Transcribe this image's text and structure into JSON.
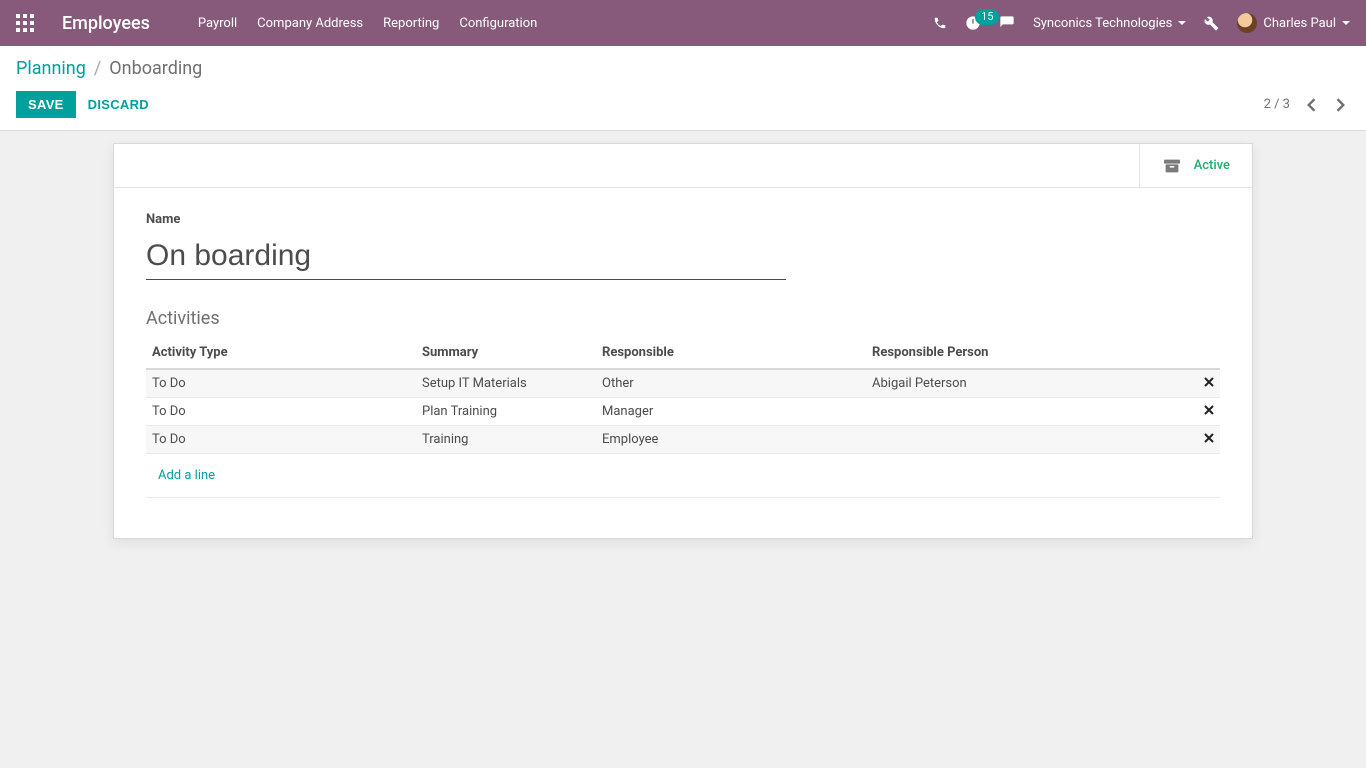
{
  "navbar": {
    "brand": "Employees",
    "menu": [
      "Payroll",
      "Company Address",
      "Reporting",
      "Configuration"
    ],
    "activity_count": "15",
    "company": "Synconics Technologies",
    "user": "Charles Paul"
  },
  "breadcrumb": {
    "parent": "Planning",
    "current": "Onboarding"
  },
  "buttons": {
    "save": "SAVE",
    "discard": "DISCARD"
  },
  "pager": {
    "text": "2 / 3"
  },
  "status_button": {
    "label": "Active"
  },
  "form": {
    "name_label": "Name",
    "name_value": "On boarding"
  },
  "activities": {
    "title": "Activities",
    "headers": {
      "type": "Activity Type",
      "summary": "Summary",
      "responsible": "Responsible",
      "person": "Responsible Person"
    },
    "rows": [
      {
        "type": "To Do",
        "summary": "Setup IT Materials",
        "responsible": "Other",
        "person": "Abigail Peterson"
      },
      {
        "type": "To Do",
        "summary": "Plan Training",
        "responsible": "Manager",
        "person": ""
      },
      {
        "type": "To Do",
        "summary": "Training",
        "responsible": "Employee",
        "person": ""
      }
    ],
    "add_line": "Add a line"
  }
}
